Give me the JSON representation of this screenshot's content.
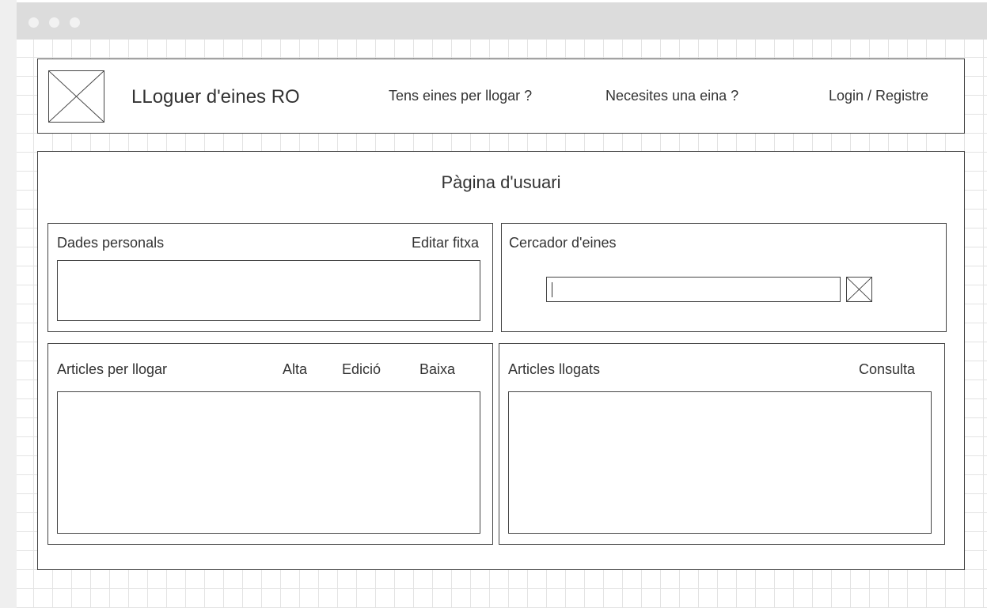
{
  "header": {
    "site_title": "LLoguer d'eines RO",
    "nav": [
      {
        "label": "Tens eines per llogar ?"
      },
      {
        "label": "Necesites una eina ?"
      },
      {
        "label": "Login / Registre"
      }
    ]
  },
  "main": {
    "page_title": "Pàgina d'usuari",
    "personal_data": {
      "title": "Dades personals",
      "action": "Editar fitxa"
    },
    "tool_search": {
      "title": "Cercador d'eines",
      "input_value": ""
    },
    "articles_to_rent": {
      "title": "Articles per llogar",
      "actions": [
        "Alta",
        "Edició",
        "Baixa"
      ]
    },
    "rented_articles": {
      "title": "Articles llogats",
      "action": "Consulta"
    }
  }
}
